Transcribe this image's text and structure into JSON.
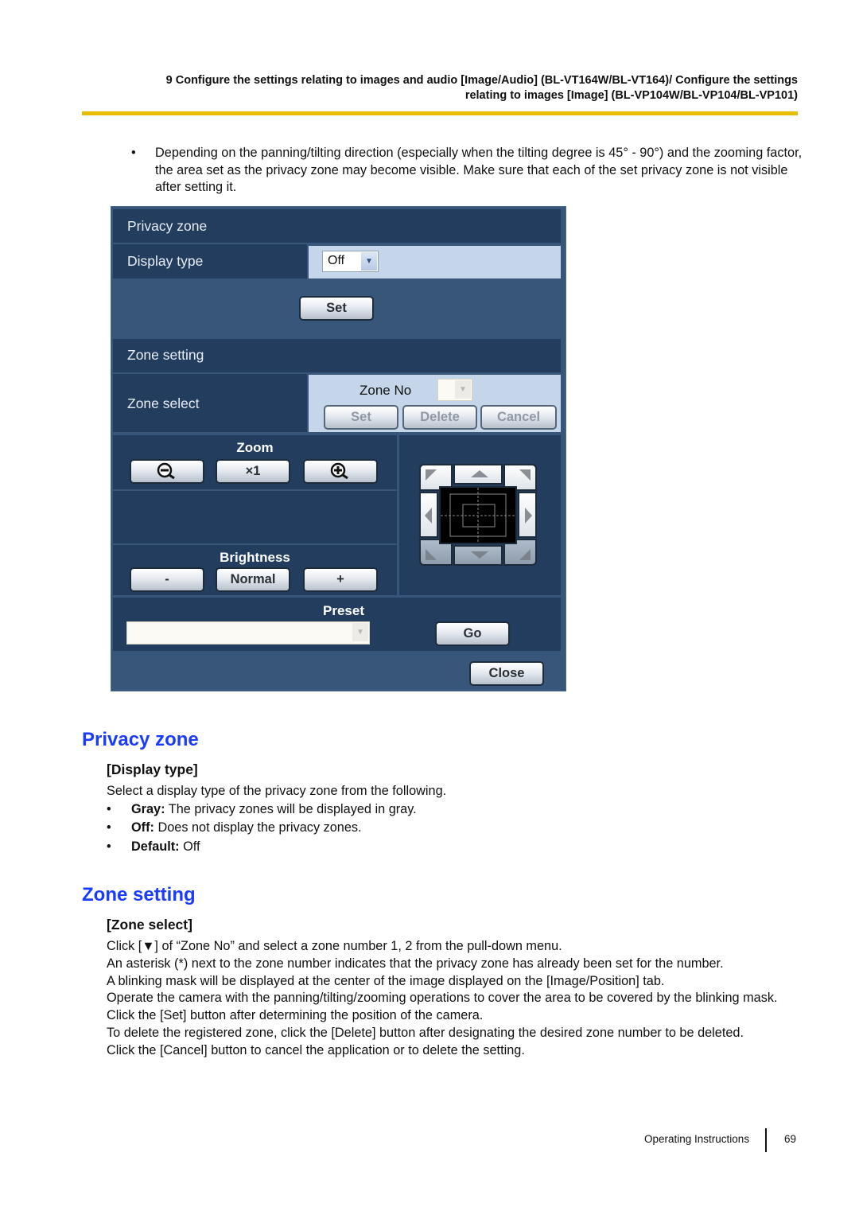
{
  "header": {
    "line1": "9 Configure the settings relating to images and audio [Image/Audio] (BL-VT164W/BL-VT164)/ Configure the settings",
    "line2": "relating to images [Image] (BL-VP104W/BL-VP104/BL-VP101)",
    "rule_color": "#e6bd00"
  },
  "note": {
    "bullet": "•",
    "text": "Depending on the panning/tilting direction (especially when the tilting degree is 45° - 90°) and the zooming factor, the area set as the privacy zone may become visible. Make sure that each of the set privacy zone is not visible after setting it."
  },
  "panel": {
    "privacy_zone_title": "Privacy zone",
    "display_type_label": "Display type",
    "display_type_value": "Off",
    "set_button": "Set",
    "zone_setting_title": "Zone setting",
    "zone_select_label": "Zone select",
    "zone_no_label": "Zone No",
    "zone_no_value": "",
    "zone_set_button": "Set",
    "zone_delete_button": "Delete",
    "zone_cancel_button": "Cancel",
    "zoom_caption": "Zoom",
    "zoom_reset_button": "×1",
    "brightness_caption": "Brightness",
    "brightness_minus": "-",
    "brightness_normal": "Normal",
    "brightness_plus": "+",
    "preset_caption": "Preset",
    "preset_value": "",
    "go_button": "Go",
    "close_button": "Close"
  },
  "sections": {
    "privacy_zone": {
      "heading": "Privacy zone",
      "sub": "[Display type]",
      "intro": "Select a display type of the privacy zone from the following.",
      "items": [
        {
          "bold": "Gray:",
          "text": " The privacy zones will be displayed in gray."
        },
        {
          "bold": "Off:",
          "text": " Does not display the privacy zones."
        },
        {
          "bold": "Default:",
          "text": " Off"
        }
      ]
    },
    "zone_setting": {
      "heading": "Zone setting",
      "sub": "[Zone select]",
      "lines": [
        "Click [▼] of “Zone No” and select a zone number 1, 2 from the pull-down menu.",
        "An asterisk (*) next to the zone number indicates that the privacy zone has already been set for the number.",
        "A blinking mask will be displayed at the center of the image displayed on the [Image/Position] tab.",
        "Operate the camera with the panning/tilting/zooming operations to cover the area to be covered by the blinking mask.",
        "Click the [Set] button after determining the position of the camera.",
        "To delete the registered zone, click the [Delete] button after designating the desired zone number to be deleted.",
        "Click the [Cancel] button to cancel the application or to delete the setting."
      ]
    }
  },
  "footer": {
    "label": "Operating Instructions",
    "page": "69"
  },
  "colors": {
    "heading_blue": "#1a3cff",
    "panel_bg": "#37567a",
    "panel_dark": "#233d5e",
    "panel_light": "#c6d6ea"
  }
}
